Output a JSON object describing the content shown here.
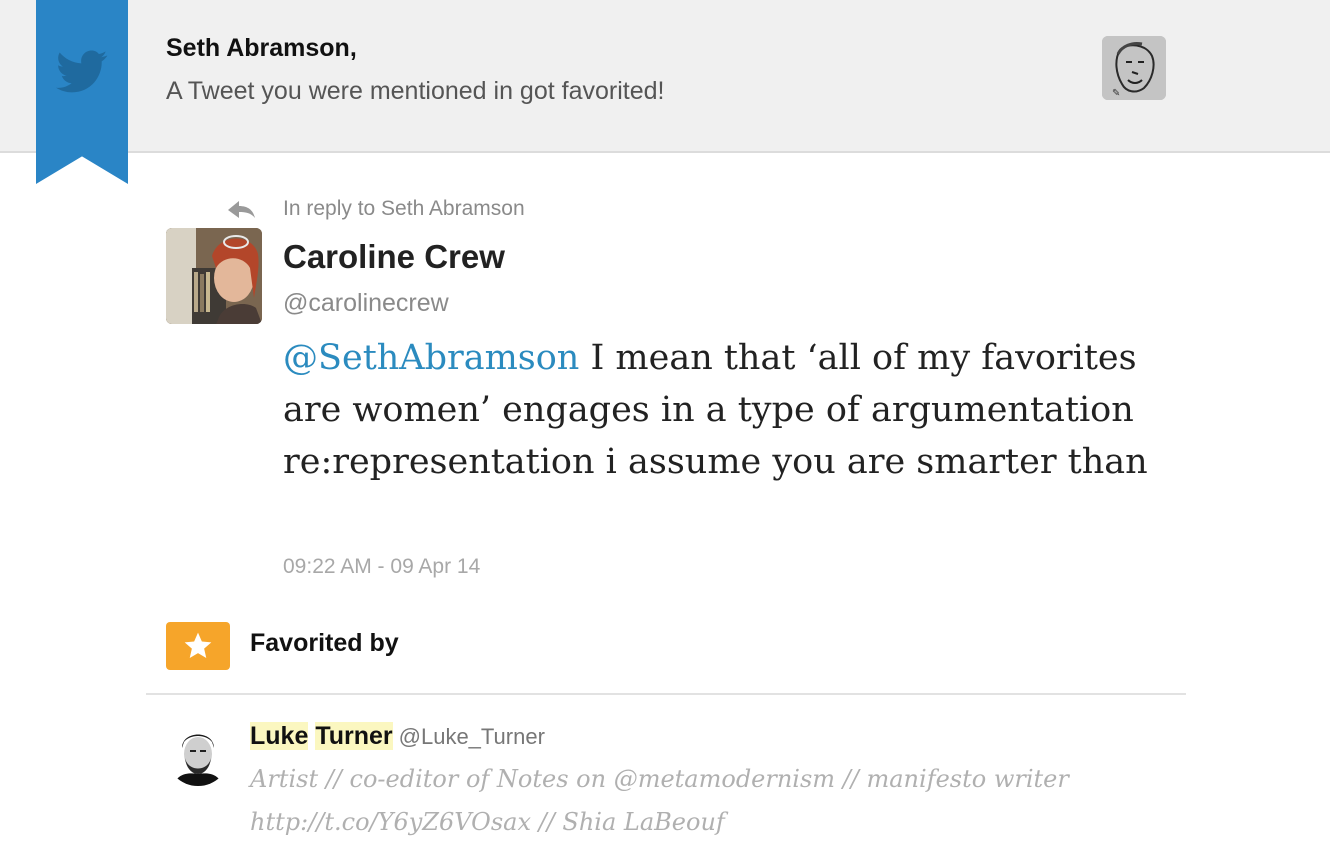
{
  "notification": {
    "recipient": "Seth Abramson,",
    "message": "A Tweet you were mentioned in got favorited!"
  },
  "tweet": {
    "reply_label": "In reply to Seth Abramson",
    "author_name": "Caroline Crew",
    "author_handle": "@carolinecrew",
    "mention": "@SethAbramson",
    "text": " I mean that ‘all of my favorites are women’ engages in a type of argumentation re:representation i assume you are smarter than",
    "timestamp": "09:22 AM - 09 Apr 14"
  },
  "favorited": {
    "title": "Favorited by",
    "users": [
      {
        "first_name": "Luke",
        "last_name": "Turner",
        "handle": "@Luke_Turner",
        "bio": "Artist // co-editor of Notes on @metamodernism // manifesto writer http://t.co/Y6yZ6VOsax // Shia LaBeouf"
      }
    ]
  },
  "colors": {
    "ribbon": "#2a85c6",
    "mention": "#2b8bbf",
    "star_badge": "#f6a52a",
    "name_highlight": "#fbf7c0"
  },
  "icons": {
    "ribbon": "twitter-bird-icon",
    "reply": "reply-arrow-icon",
    "favorite": "star-icon"
  }
}
